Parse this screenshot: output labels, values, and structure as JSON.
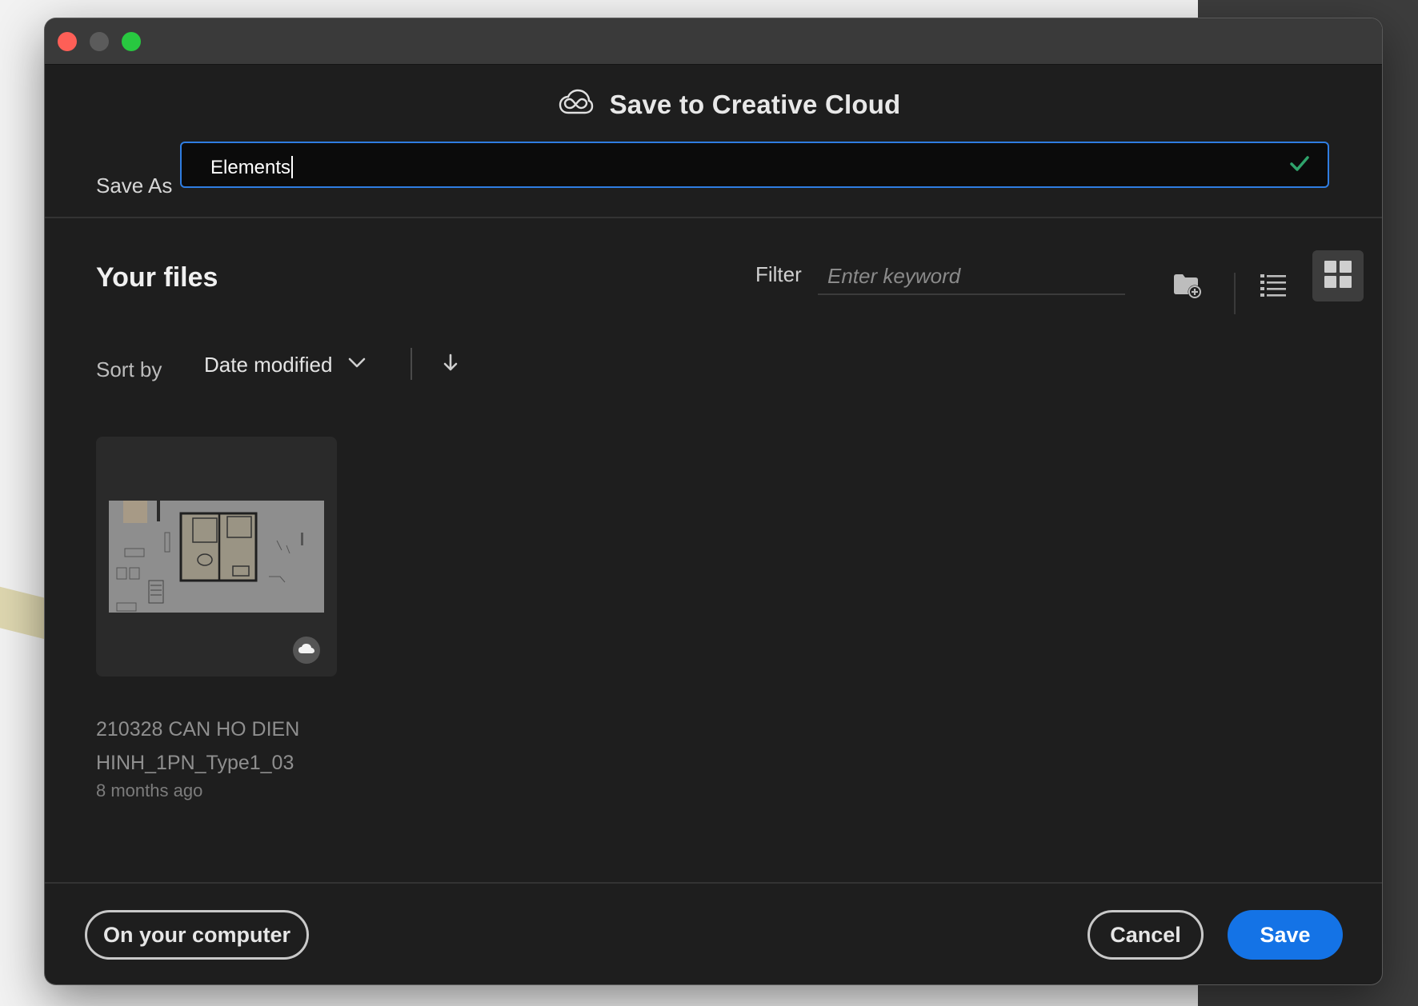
{
  "dialog": {
    "title": "Save to Creative Cloud",
    "save_as_label": "Save As",
    "save_as_value": "Elements"
  },
  "files": {
    "heading": "Your files",
    "filter_label": "Filter",
    "filter_placeholder": "Enter keyword",
    "sort_label": "Sort by",
    "sort_value": "Date modified",
    "items": [
      {
        "name_line1": "210328 CAN HO DIEN",
        "name_line2": "HINH_1PN_Type1_03",
        "modified": "8 months ago",
        "badge_icon": "cloud-icon"
      }
    ]
  },
  "footer": {
    "computer_label": "On your computer",
    "cancel_label": "Cancel",
    "save_label": "Save"
  },
  "icons": {
    "title": "creative-cloud-icon",
    "new_folder": "new-folder-icon",
    "list_view": "list-view-icon",
    "grid_view": "grid-view-icon",
    "sort_direction": "arrow-down-icon",
    "sort_dropdown": "chevron-down-icon",
    "valid": "checkmark-icon"
  },
  "colors": {
    "accent": "#1473e6",
    "focus_border": "#2f7de1",
    "check": "#2fa36b",
    "window_bg": "#1e1e1e"
  }
}
